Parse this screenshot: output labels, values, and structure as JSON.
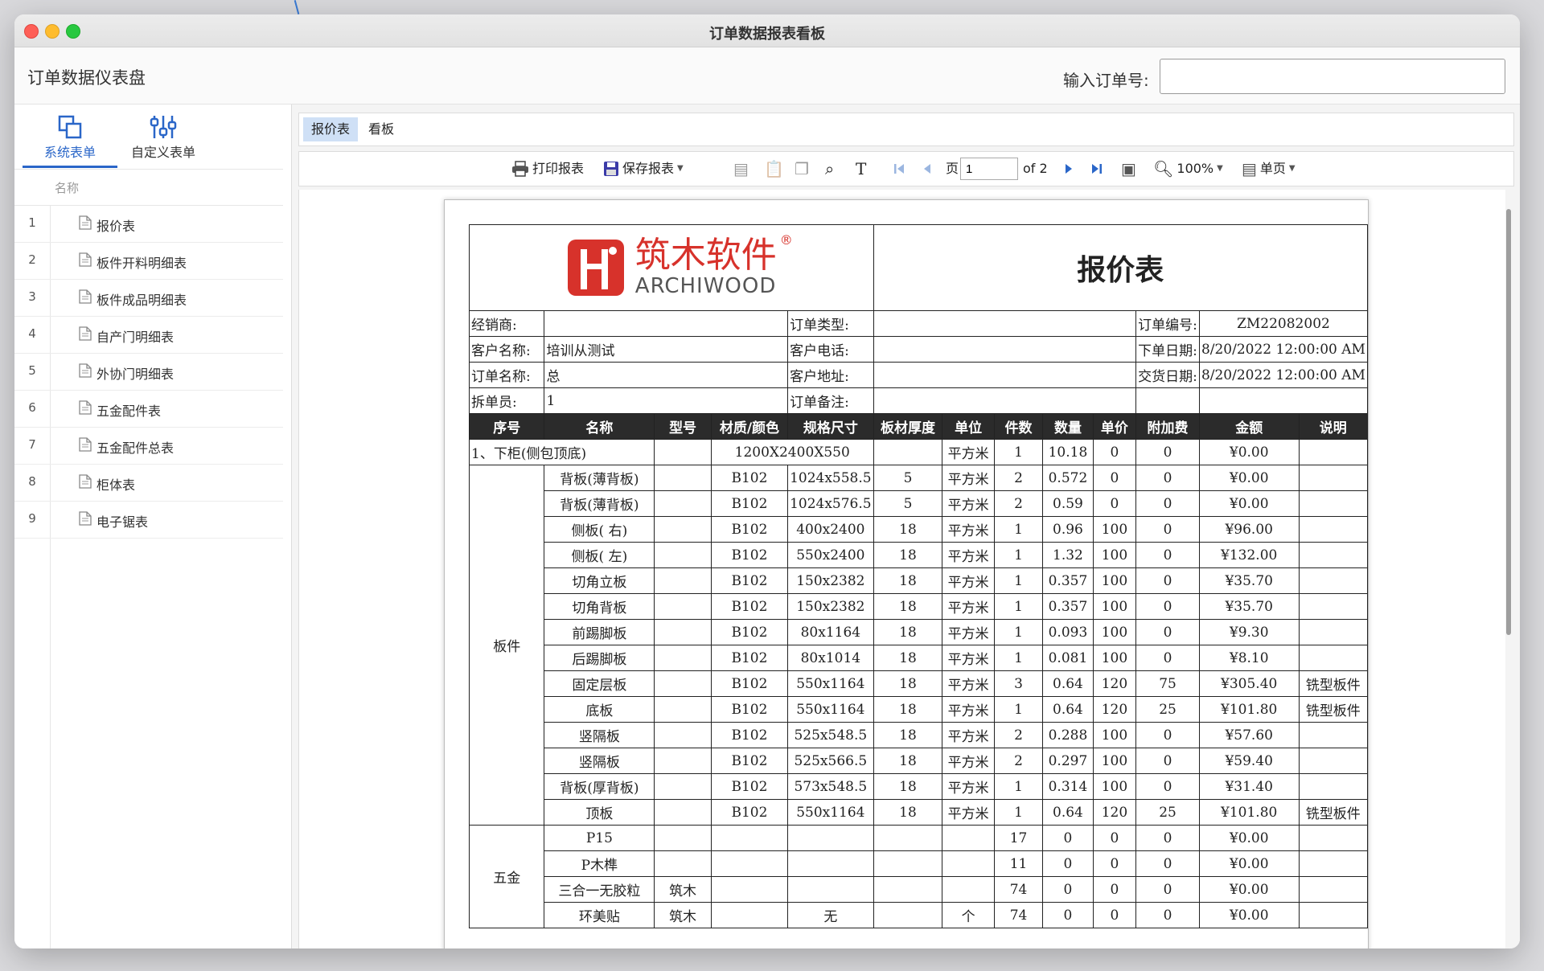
{
  "window": {
    "title": "订单数据报表看板"
  },
  "header": {
    "app_title": "订单数据仪表盘",
    "order_label": "输入订单号:",
    "order_value": ""
  },
  "sidebar": {
    "tabs": [
      {
        "label": "系统表单"
      },
      {
        "label": "自定义表单"
      }
    ],
    "column_name": "名称",
    "items": [
      {
        "num": "1",
        "label": "报价表"
      },
      {
        "num": "2",
        "label": "板件开料明细表"
      },
      {
        "num": "3",
        "label": "板件成品明细表"
      },
      {
        "num": "4",
        "label": "自产门明细表"
      },
      {
        "num": "5",
        "label": "外协门明细表"
      },
      {
        "num": "6",
        "label": "五金配件表"
      },
      {
        "num": "7",
        "label": "五金配件总表"
      },
      {
        "num": "8",
        "label": "柜体表"
      },
      {
        "num": "9",
        "label": "电子锯表"
      }
    ]
  },
  "tabs": [
    {
      "label": "报价表"
    },
    {
      "label": "看板"
    }
  ],
  "toolbar": {
    "print": "打印报表",
    "save": "保存报表",
    "page_prefix": "页",
    "page_value": "1",
    "page_of": "of 2",
    "zoom": "100%",
    "view_mode": "单页"
  },
  "report": {
    "brand_cn": "筑木软件",
    "brand_en": "ARCHIWOOD",
    "brand_reg": "®",
    "title": "报价表",
    "info": [
      [
        "经销商:",
        "",
        "订单类型:",
        "",
        "订单编号:",
        "ZM22082002"
      ],
      [
        "客户名称:",
        "培训从测试",
        "客户电话:",
        "",
        "下单日期:",
        "8/20/2022 12:00:00 AM"
      ],
      [
        "订单名称:",
        "总",
        "客户地址:",
        "",
        "交货日期:",
        "8/20/2022 12:00:00 AM"
      ],
      [
        "拆单员:",
        "1",
        "订单备注:",
        "",
        "",
        ""
      ]
    ],
    "columns": [
      "序号",
      "名称",
      "型号",
      "材质/颜色",
      "规格尺寸",
      "板材厚度",
      "单位",
      "件数",
      "数量",
      "单价",
      "附加费",
      "金额",
      "说明"
    ],
    "section_row": {
      "label": "1、下柜(侧包顶底)",
      "spec": "1200X2400X550",
      "unit": "平方米",
      "pieces": "1",
      "qty": "10.18",
      "price": "0",
      "extra": "0",
      "amount": "¥0.00",
      "note": ""
    },
    "groups": [
      {
        "name": "板件",
        "rows": [
          [
            "背板(薄背板)",
            "",
            "B102",
            "1024x558.5",
            "5",
            "平方米",
            "2",
            "0.572",
            "0",
            "0",
            "¥0.00",
            ""
          ],
          [
            "背板(薄背板)",
            "",
            "B102",
            "1024x576.5",
            "5",
            "平方米",
            "2",
            "0.59",
            "0",
            "0",
            "¥0.00",
            ""
          ],
          [
            "侧板( 右)",
            "",
            "B102",
            "400x2400",
            "18",
            "平方米",
            "1",
            "0.96",
            "100",
            "0",
            "¥96.00",
            ""
          ],
          [
            "侧板( 左)",
            "",
            "B102",
            "550x2400",
            "18",
            "平方米",
            "1",
            "1.32",
            "100",
            "0",
            "¥132.00",
            ""
          ],
          [
            "切角立板",
            "",
            "B102",
            "150x2382",
            "18",
            "平方米",
            "1",
            "0.357",
            "100",
            "0",
            "¥35.70",
            ""
          ],
          [
            "切角背板",
            "",
            "B102",
            "150x2382",
            "18",
            "平方米",
            "1",
            "0.357",
            "100",
            "0",
            "¥35.70",
            ""
          ],
          [
            "前踢脚板",
            "",
            "B102",
            "80x1164",
            "18",
            "平方米",
            "1",
            "0.093",
            "100",
            "0",
            "¥9.30",
            ""
          ],
          [
            "后踢脚板",
            "",
            "B102",
            "80x1014",
            "18",
            "平方米",
            "1",
            "0.081",
            "100",
            "0",
            "¥8.10",
            ""
          ],
          [
            "固定层板",
            "",
            "B102",
            "550x1164",
            "18",
            "平方米",
            "3",
            "0.64",
            "120",
            "75",
            "¥305.40",
            "铣型板件"
          ],
          [
            "底板",
            "",
            "B102",
            "550x1164",
            "18",
            "平方米",
            "1",
            "0.64",
            "120",
            "25",
            "¥101.80",
            "铣型板件"
          ],
          [
            "竖隔板",
            "",
            "B102",
            "525x548.5",
            "18",
            "平方米",
            "2",
            "0.288",
            "100",
            "0",
            "¥57.60",
            ""
          ],
          [
            "竖隔板",
            "",
            "B102",
            "525x566.5",
            "18",
            "平方米",
            "2",
            "0.297",
            "100",
            "0",
            "¥59.40",
            ""
          ],
          [
            "背板(厚背板)",
            "",
            "B102",
            "573x548.5",
            "18",
            "平方米",
            "1",
            "0.314",
            "100",
            "0",
            "¥31.40",
            ""
          ],
          [
            "顶板",
            "",
            "B102",
            "550x1164",
            "18",
            "平方米",
            "1",
            "0.64",
            "120",
            "25",
            "¥101.80",
            "铣型板件"
          ]
        ]
      },
      {
        "name": "五金",
        "rows": [
          [
            "P15",
            "",
            "",
            "",
            "",
            "",
            "17",
            "0",
            "0",
            "0",
            "¥0.00",
            ""
          ],
          [
            "P木榫",
            "",
            "",
            "",
            "",
            "",
            "11",
            "0",
            "0",
            "0",
            "¥0.00",
            ""
          ],
          [
            "三合一无胶粒",
            "筑木",
            "",
            "",
            "",
            "",
            "74",
            "0",
            "0",
            "0",
            "¥0.00",
            ""
          ],
          [
            "环美贴",
            "筑木",
            "",
            "无",
            "",
            "个",
            "74",
            "0",
            "0",
            "0",
            "¥0.00",
            ""
          ]
        ]
      }
    ]
  }
}
